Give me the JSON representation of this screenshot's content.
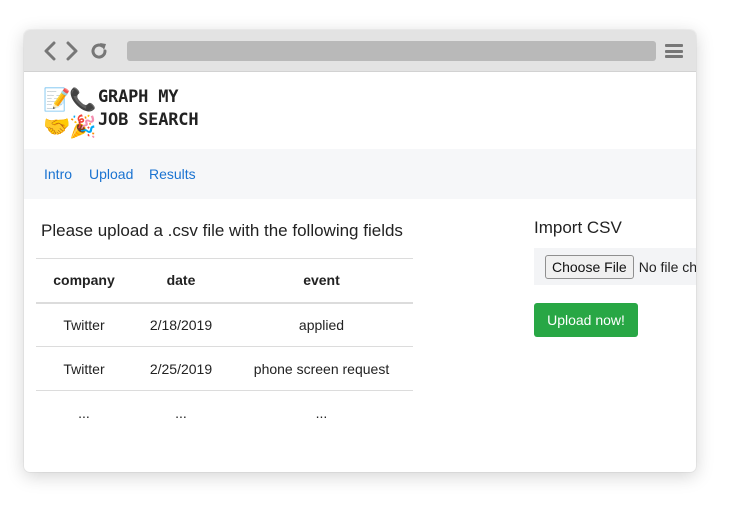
{
  "browser": {
    "back_icon": "chevron-left-icon",
    "forward_icon": "chevron-right-icon",
    "reload_icon": "reload-icon",
    "menu_icon": "hamburger-menu-icon"
  },
  "header": {
    "logo_emoji": [
      "📝",
      "📞",
      "🤝",
      "🎉"
    ],
    "brand_line1": "GRAPH MY",
    "brand_line2": "JOB SEARCH"
  },
  "nav": {
    "items": [
      {
        "label": "Intro"
      },
      {
        "label": "Upload"
      },
      {
        "label": "Results"
      }
    ]
  },
  "main": {
    "lead": "Please upload a .csv file with the following fields",
    "table": {
      "columns": [
        "company",
        "date",
        "event"
      ],
      "rows": [
        [
          "Twitter",
          "2/18/2019",
          "applied"
        ],
        [
          "Twitter",
          "2/25/2019",
          "phone screen request"
        ],
        [
          "...",
          "...",
          "..."
        ]
      ]
    }
  },
  "import": {
    "title": "Import CSV",
    "choose_label": "Choose File",
    "no_file_label": "No file chosen",
    "upload_label": "Upload now!",
    "upload_color": "#28a745"
  },
  "colors": {
    "link": "#1a73d1",
    "navbar_bg": "#f6f7f9",
    "chrome_bg": "#e3e3e3"
  }
}
